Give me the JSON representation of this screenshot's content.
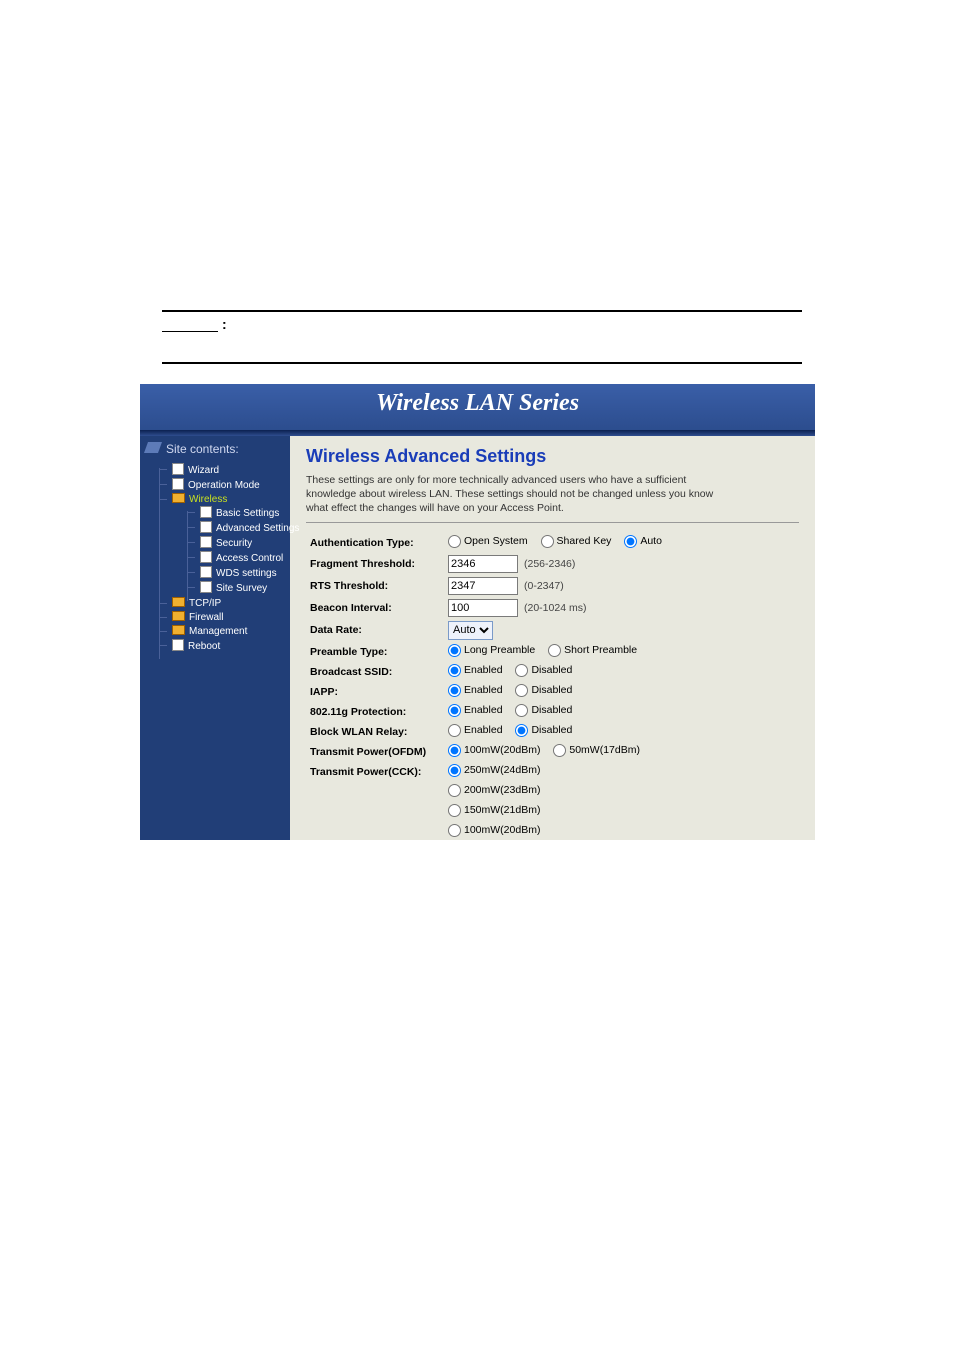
{
  "banner": {
    "title": "Wireless LAN Series"
  },
  "sidebar": {
    "title": "Site contents:",
    "items": [
      "Wizard",
      "Operation Mode",
      "Wireless",
      "TCP/IP",
      "Firewall",
      "Management",
      "Reboot"
    ],
    "wireless_sub": [
      "Basic Settings",
      "Advanced Settings",
      "Security",
      "Access Control",
      "WDS settings",
      "Site Survey"
    ]
  },
  "main": {
    "title": "Wireless Advanced Settings",
    "description": "These settings are only for more technically advanced users who have a sufficient knowledge about wireless LAN. These settings should not be changed unless you know what effect the changes will have on your Access Point.",
    "fields": {
      "auth_type": {
        "label": "Authentication Type:",
        "options": [
          "Open System",
          "Shared Key",
          "Auto"
        ],
        "selected": "Auto"
      },
      "fragment": {
        "label": "Fragment Threshold:",
        "value": "2346",
        "hint": "(256-2346)"
      },
      "rts": {
        "label": "RTS Threshold:",
        "value": "2347",
        "hint": "(0-2347)"
      },
      "beacon": {
        "label": "Beacon Interval:",
        "value": "100",
        "hint": "(20-1024 ms)"
      },
      "data_rate": {
        "label": "Data Rate:",
        "value": "Auto"
      },
      "preamble": {
        "label": "Preamble Type:",
        "options": [
          "Long Preamble",
          "Short Preamble"
        ],
        "selected": "Long Preamble"
      },
      "bcast_ssid": {
        "label": "Broadcast SSID:",
        "options": [
          "Enabled",
          "Disabled"
        ],
        "selected": "Enabled"
      },
      "iapp": {
        "label": "IAPP:",
        "options": [
          "Enabled",
          "Disabled"
        ],
        "selected": "Enabled"
      },
      "protection": {
        "label": "802.11g Protection:",
        "options": [
          "Enabled",
          "Disabled"
        ],
        "selected": "Enabled"
      },
      "block_relay": {
        "label": "Block WLAN Relay:",
        "options": [
          "Enabled",
          "Disabled"
        ],
        "selected": "Disabled"
      },
      "tx_ofdm": {
        "label": "Transmit Power(OFDM)",
        "options": [
          "100mW(20dBm)",
          "50mW(17dBm)"
        ],
        "selected": "100mW(20dBm)"
      },
      "tx_cck": {
        "label": "Transmit Power(CCK):",
        "options": [
          "250mW(24dBm)",
          "200mW(23dBm)",
          "150mW(21dBm)",
          "100mW(20dBm)"
        ],
        "selected": "250mW(24dBm)"
      }
    }
  }
}
